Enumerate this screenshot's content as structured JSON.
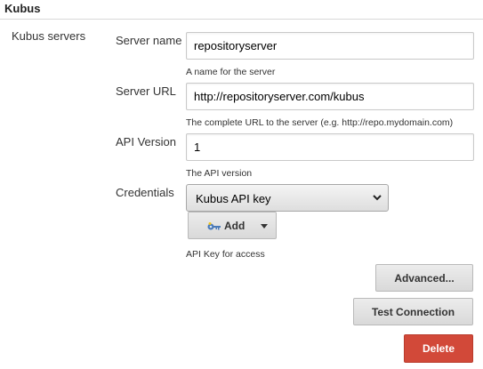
{
  "section": {
    "title": "Kubus"
  },
  "group": {
    "label": "Kubus servers"
  },
  "server_name": {
    "label": "Server name",
    "value": "repositoryserver",
    "help": "A name for the server"
  },
  "server_url": {
    "label": "Server URL",
    "value": "http://repositoryserver.com/kubus",
    "help": "The complete URL to the server (e.g. http://repo.mydomain.com)"
  },
  "api_version": {
    "label": "API Version",
    "value": "1",
    "help": "The API version"
  },
  "credentials": {
    "label": "Credentials",
    "selected": "Kubus API key",
    "add_label": "Add",
    "help": "API Key for access"
  },
  "buttons": {
    "advanced": "Advanced...",
    "test_connection": "Test Connection",
    "delete": "Delete"
  },
  "colors": {
    "delete_bg": "#d24939",
    "key_icon": "#4a7ab8"
  }
}
